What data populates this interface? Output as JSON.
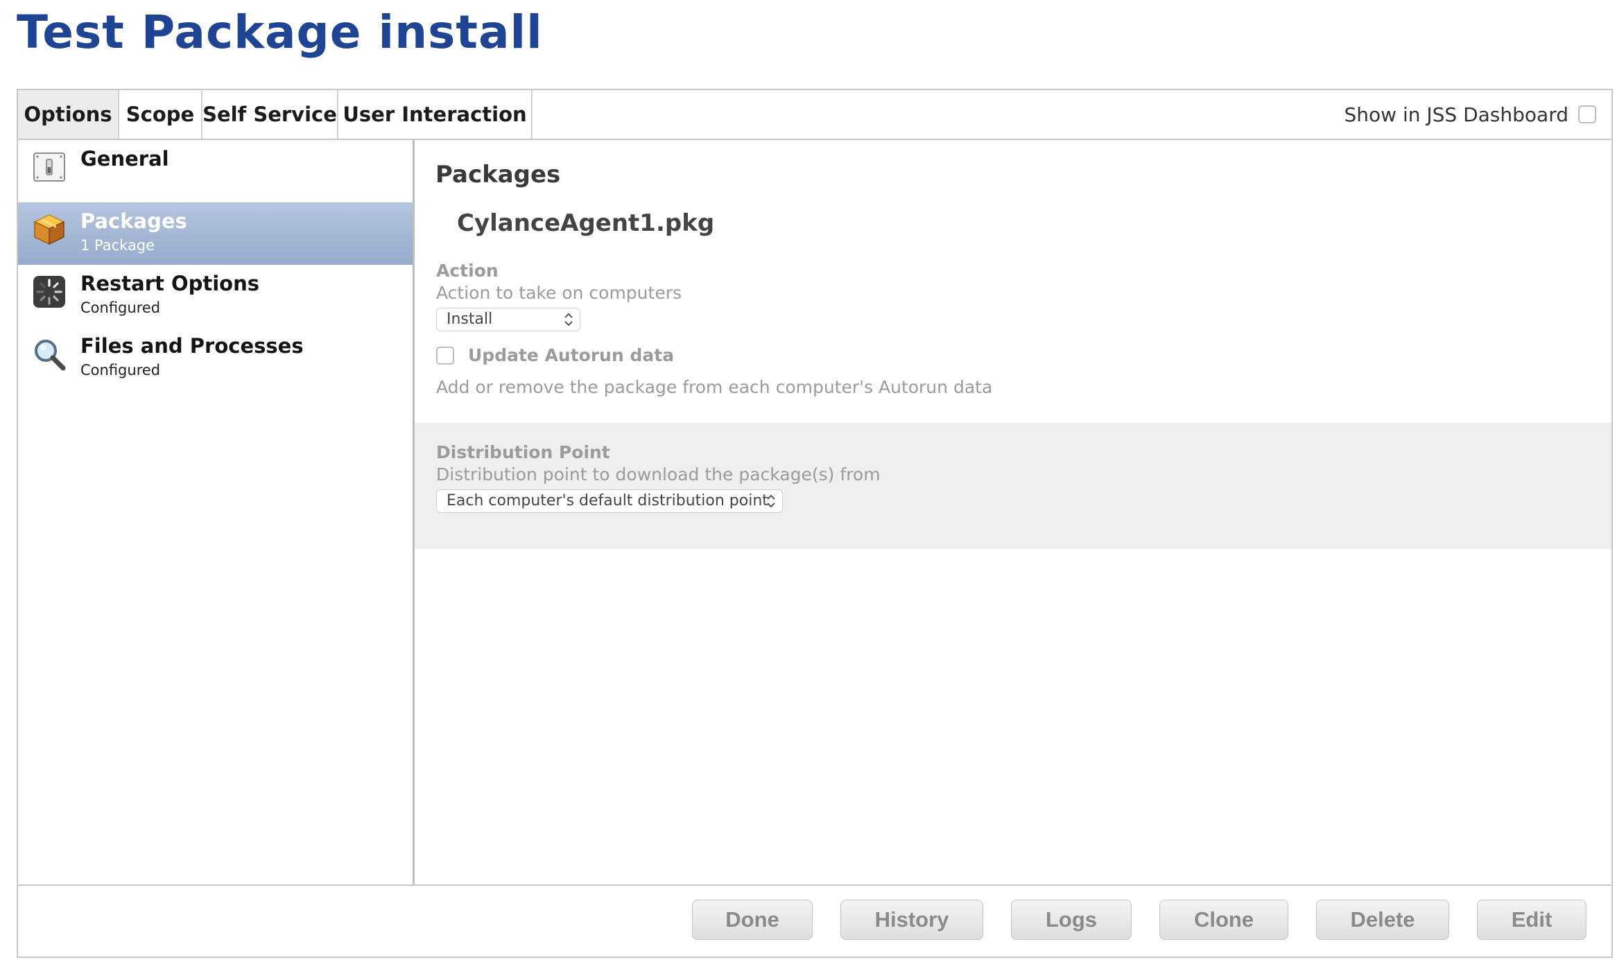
{
  "page": {
    "title": "Test Package install"
  },
  "tabs": [
    {
      "label": "Options",
      "active": true
    },
    {
      "label": "Scope",
      "active": false
    },
    {
      "label": "Self Service",
      "active": false
    },
    {
      "label": "User Interaction",
      "active": false
    }
  ],
  "dashboard": {
    "label": "Show in JSS Dashboard",
    "checked": false
  },
  "sidebar": {
    "items": [
      {
        "label": "General",
        "sub": "",
        "icon": "switch-icon",
        "selected": false
      },
      {
        "label": "Packages",
        "sub": "1 Package",
        "icon": "package-box-icon",
        "selected": true
      },
      {
        "label": "Restart Options",
        "sub": "Configured",
        "icon": "restart-spinner-icon",
        "selected": false
      },
      {
        "label": "Files and Processes",
        "sub": "Configured",
        "icon": "magnifier-icon",
        "selected": false
      }
    ]
  },
  "main": {
    "section_title": "Packages",
    "package_name": "CylanceAgent1.pkg",
    "action": {
      "label": "Action",
      "description": "Action to take on computers",
      "selected": "Install"
    },
    "autorun": {
      "label": "Update Autorun data",
      "description": "Add or remove the package from each computer's Autorun data",
      "checked": false
    },
    "distribution": {
      "label": "Distribution Point",
      "description": "Distribution point to download the package(s) from",
      "selected": "Each computer's default distribution point"
    }
  },
  "footer": {
    "buttons": [
      "Done",
      "History",
      "Logs",
      "Clone",
      "Delete",
      "Edit"
    ]
  },
  "colors": {
    "title": "#1e4493",
    "selection": "#9fb3d3",
    "disabled_text": "#9b9b9b"
  }
}
